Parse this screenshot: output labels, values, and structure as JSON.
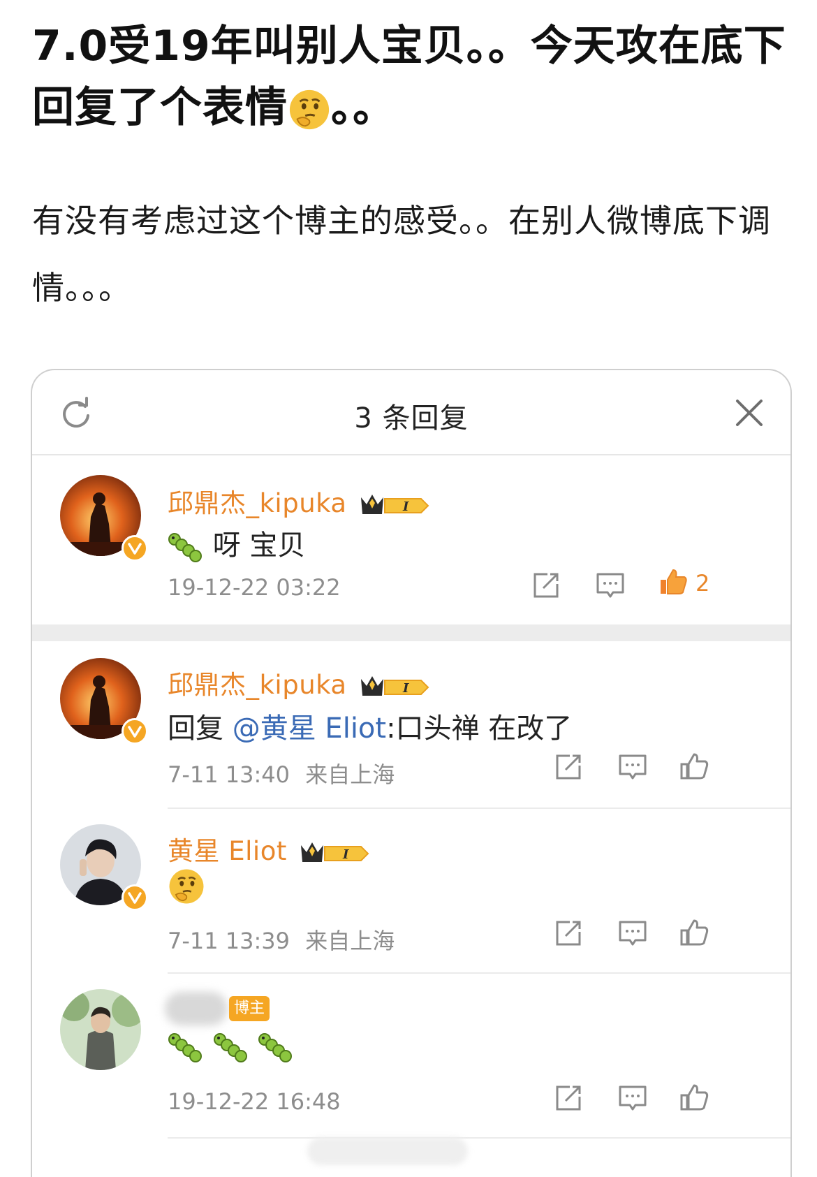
{
  "post": {
    "title": "7.0受19年叫别人宝贝。。今天攻在底下回复了个表情",
    "title_suffix": "。。",
    "body": "有没有考虑过这个博主的感受。。在别人微博底下调情。。。"
  },
  "panel": {
    "title": "3 条回复",
    "refresh_icon": "refresh-icon",
    "close_icon": "close-icon"
  },
  "main_comment": {
    "username": "邱鼎杰_kipuka",
    "text": "呀 宝贝",
    "time": "19-12-22 03:22",
    "like_count": "2"
  },
  "replies": [
    {
      "username": "邱鼎杰_kipuka",
      "prefix": "回复 ",
      "mention": "@黄星 Eliot",
      "text": ":口头禅 在改了",
      "time": "7-11 13:40",
      "location": "来自上海"
    },
    {
      "username": "黄星 Eliot",
      "text": "",
      "time": "7-11 13:39",
      "location": "来自上海"
    },
    {
      "badge": "博主",
      "text": "",
      "time": "19-12-22 16:48"
    }
  ],
  "colors": {
    "username": "#e8862a",
    "mention": "#3a6ab5",
    "meta": "#8d8d8d",
    "badge": "#f5a623"
  }
}
